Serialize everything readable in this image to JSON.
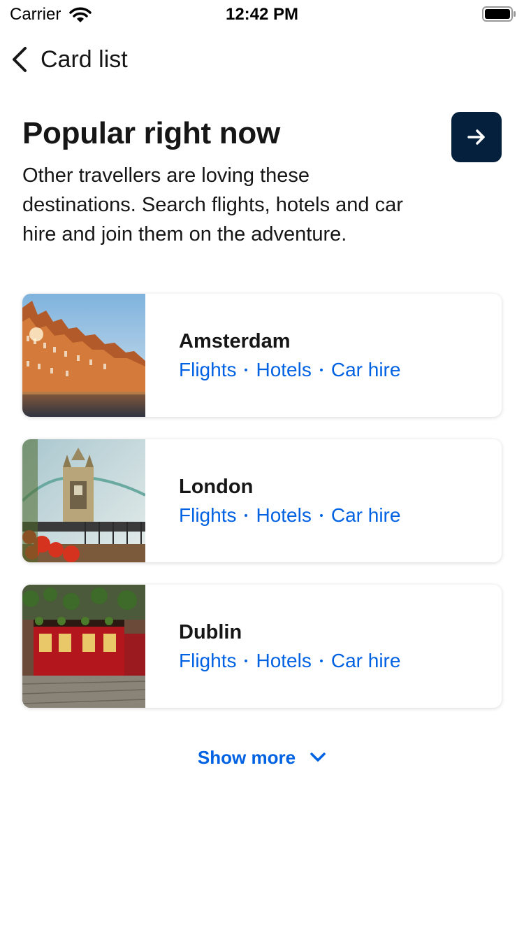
{
  "status_bar": {
    "carrier": "Carrier",
    "time": "12:42 PM",
    "wifi_icon": "wifi-icon",
    "battery_icon": "battery-icon"
  },
  "nav": {
    "back_icon": "chevron-left-icon",
    "title": "Card list"
  },
  "header": {
    "title": "Popular right now",
    "description": "Other travellers are loving these destinations. Search flights, hotels and car hire and join them on the adventure.",
    "arrow_icon": "arrow-right-icon"
  },
  "cards": [
    {
      "city": "Amsterdam",
      "links": [
        "Flights",
        "Hotels",
        "Car hire"
      ],
      "image": "amsterdam-canal-houses"
    },
    {
      "city": "London",
      "links": [
        "Flights",
        "Hotels",
        "Car hire"
      ],
      "image": "london-tower-bridge"
    },
    {
      "city": "Dublin",
      "links": [
        "Flights",
        "Hotels",
        "Car hire"
      ],
      "image": "dublin-temple-bar-pub"
    }
  ],
  "show_more": {
    "label": "Show more",
    "icon": "chevron-down-icon"
  },
  "colors": {
    "accent": "#0062e3",
    "dark_button": "#05203c",
    "text": "#161616"
  }
}
